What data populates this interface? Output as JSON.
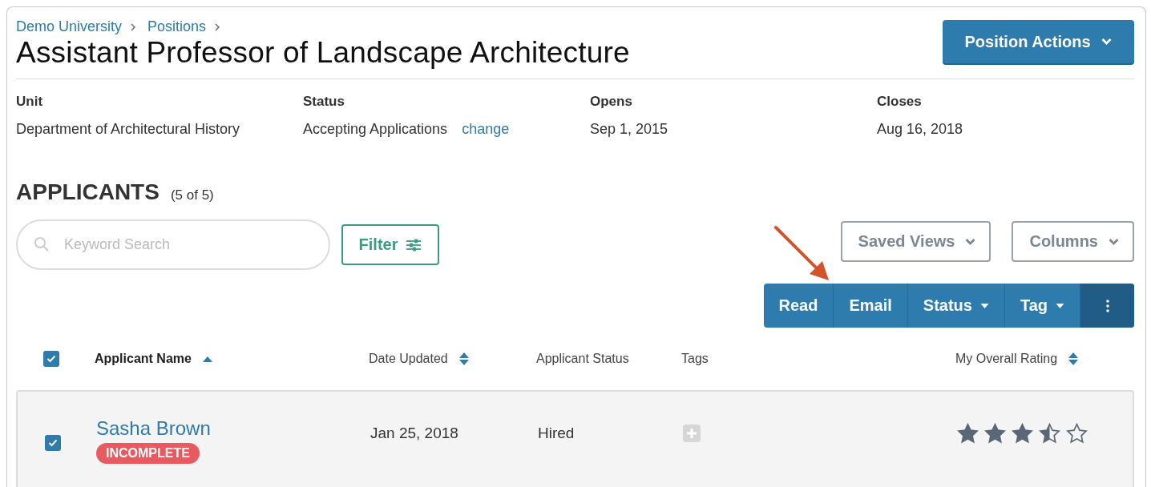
{
  "breadcrumbs": [
    {
      "label": "Demo University"
    },
    {
      "label": "Positions"
    }
  ],
  "title": "Assistant Professor of Landscape Architecture",
  "position_actions": {
    "label": "Position Actions"
  },
  "details": [
    {
      "label": "Unit",
      "value": "Department of Architectural History"
    },
    {
      "label": "Status",
      "value": "Accepting Applications",
      "link": "change"
    },
    {
      "label": "Opens",
      "value": "Sep 1, 2015"
    },
    {
      "label": "Closes",
      "value": "Aug 16, 2018"
    }
  ],
  "applicants": {
    "heading": "APPLICANTS",
    "count": "(5 of 5)"
  },
  "search": {
    "placeholder": "Keyword Search"
  },
  "filter_button": {
    "label": "Filter"
  },
  "view_buttons": [
    {
      "label": "Saved Views"
    },
    {
      "label": "Columns"
    }
  ],
  "bulk_actions": [
    {
      "kind": "button",
      "label": "Read"
    },
    {
      "kind": "button",
      "label": "Email"
    },
    {
      "kind": "dropdown",
      "label": "Status"
    },
    {
      "kind": "dropdown",
      "label": "Tag"
    },
    {
      "kind": "more"
    }
  ],
  "table": {
    "select_all": {
      "checked": true
    },
    "columns": [
      {
        "label": "Applicant Name",
        "sortable": true,
        "sorted_ascending": true
      },
      {
        "label": "Date Updated",
        "sortable": true,
        "sorted_ascending": false
      },
      {
        "label": "Applicant Status",
        "sortable": false,
        "sorted_ascending": false
      },
      {
        "label": "Tags",
        "sortable": false,
        "sorted_ascending": false
      },
      {
        "label": "My Overall Rating",
        "sortable": true,
        "sorted_ascending": false
      }
    ],
    "rows": [
      {
        "selected": true,
        "name": "Sasha Brown",
        "badge": "INCOMPLETE",
        "date": "Jan 25, 2018",
        "status": "Hired",
        "stars": 3.5
      }
    ]
  }
}
